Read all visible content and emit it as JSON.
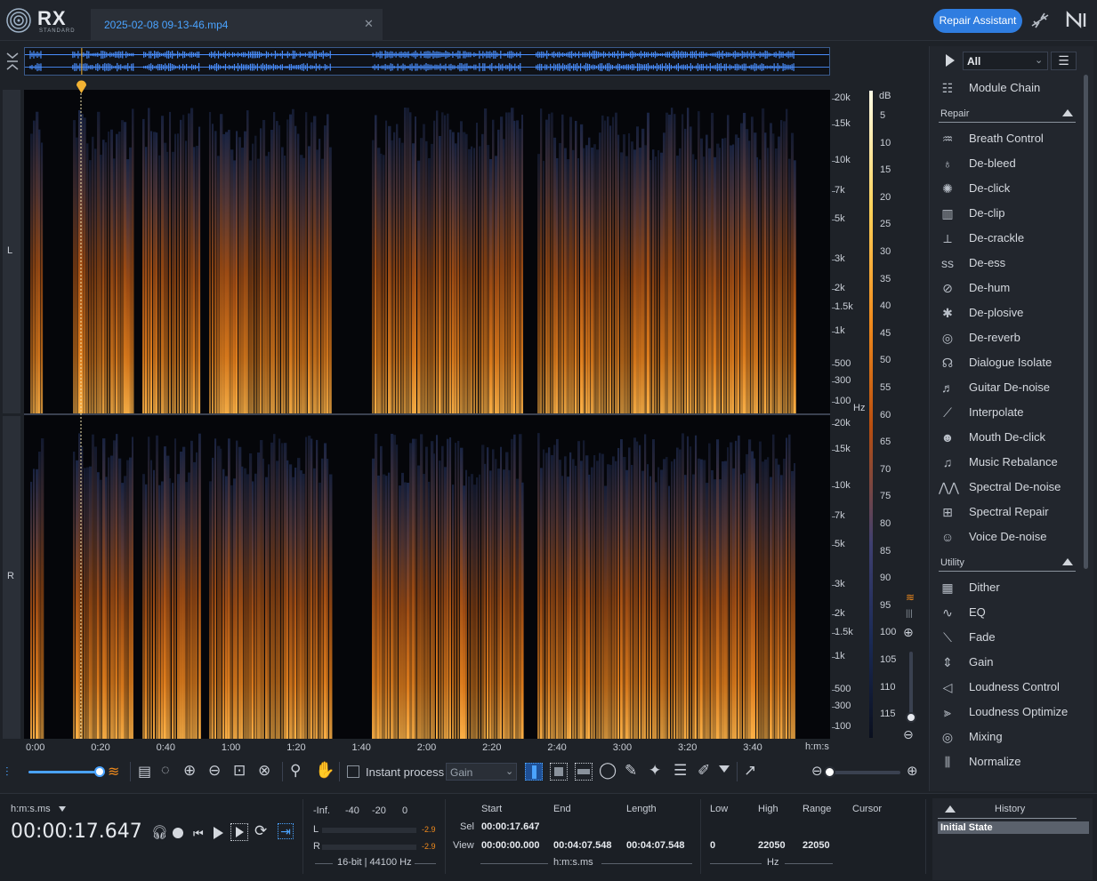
{
  "app": {
    "logo_text": "RX",
    "logo_sub": "STANDARD"
  },
  "tab": {
    "filename": "2025-02-08 09-13-46.mp4",
    "close": "✕"
  },
  "header": {
    "repair_assistant": "Repair Assistant"
  },
  "channels": {
    "left": "L",
    "right": "R"
  },
  "freq_axis": {
    "labels": [
      "20k",
      "15k",
      "10k",
      "7k",
      "5k",
      "3k",
      "2k",
      "1.5k",
      "1k",
      "500",
      "300",
      "100"
    ],
    "unit": "Hz"
  },
  "db_axis": {
    "unit": "dB",
    "labels": [
      "5",
      "10",
      "15",
      "20",
      "25",
      "30",
      "35",
      "40",
      "45",
      "50",
      "55",
      "60",
      "65",
      "70",
      "75",
      "80",
      "85",
      "90",
      "95",
      "100",
      "105",
      "110",
      "115"
    ]
  },
  "time_axis": {
    "labels": [
      "0:00",
      "0:20",
      "0:40",
      "1:00",
      "1:20",
      "1:40",
      "2:00",
      "2:20",
      "2:40",
      "3:00",
      "3:20",
      "3:40"
    ],
    "unit": "h:m:s"
  },
  "toolbar": {
    "instant_process": "Instant process",
    "mode": "Gain"
  },
  "modules": {
    "filter": "All",
    "module_chain": "Module Chain",
    "repair_label": "Repair",
    "repair": [
      "Breath Control",
      "De-bleed",
      "De-click",
      "De-clip",
      "De-crackle",
      "De-ess",
      "De-hum",
      "De-plosive",
      "De-reverb",
      "Dialogue Isolate",
      "Guitar De-noise",
      "Interpolate",
      "Mouth De-click",
      "Music Rebalance",
      "Spectral De-noise",
      "Spectral Repair",
      "Voice De-noise"
    ],
    "utility_label": "Utility",
    "utility": [
      "Dither",
      "EQ",
      "Fade",
      "Gain",
      "Loudness Control",
      "Loudness Optimize",
      "Mixing",
      "Normalize"
    ]
  },
  "transport": {
    "format": "h:m:s.ms",
    "time": "00:00:17.647"
  },
  "meter": {
    "scale": [
      "-Inf.",
      "-40",
      "-20",
      "0"
    ],
    "l": "L",
    "r": "R",
    "l_peak": "-2.9",
    "r_peak": "-2.9",
    "format": "16-bit | 44100 Hz"
  },
  "selection": {
    "headers": {
      "start": "Start",
      "end": "End",
      "length": "Length",
      "low": "Low",
      "high": "High",
      "range": "Range",
      "cursor": "Cursor"
    },
    "sel_label": "Sel",
    "sel_start": "00:00:17.647",
    "view_label": "View",
    "view_start": "00:00:00.000",
    "view_end": "00:04:07.548",
    "view_length": "00:04:07.548",
    "low": "0",
    "high": "22050",
    "range": "22050",
    "time_unit": "h:m:s.ms",
    "freq_unit": "Hz"
  },
  "history": {
    "title": "History",
    "items": [
      "Initial State"
    ]
  },
  "colors": {
    "accent": "#2f7de0",
    "link": "#4aa3ff",
    "playhead": "#f2b233"
  }
}
